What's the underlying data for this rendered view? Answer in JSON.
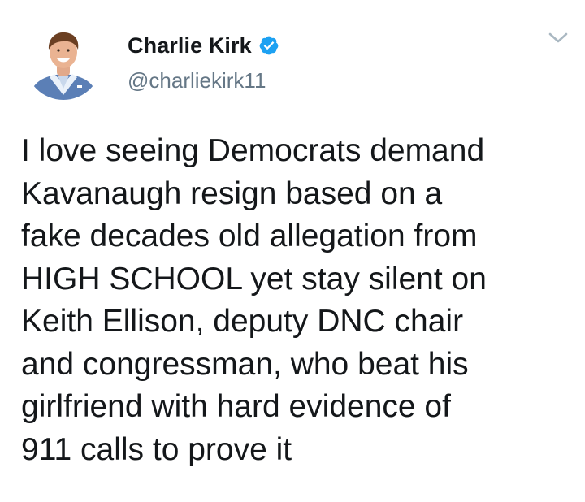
{
  "author": {
    "display_name": "Charlie Kirk",
    "handle": "@charliekirk11",
    "verified": true,
    "avatar_icon": "profile-photo"
  },
  "tweet": {
    "text": "I love seeing Democrats demand\nKavanaugh resign based on a\nfake decades old allegation from\nHIGH SCHOOL yet stay silent on\nKeith Ellison, deputy DNC chair\nand congressman, who beat his\ngirlfriend with hard evidence of\n911 calls to prove it"
  },
  "controls": {
    "menu_icon": "chevron-down-icon"
  },
  "colors": {
    "verified_badge": "#1da1f2",
    "handle_text": "#657786",
    "body_text": "#14171a",
    "chevron": "#aab8c2"
  }
}
